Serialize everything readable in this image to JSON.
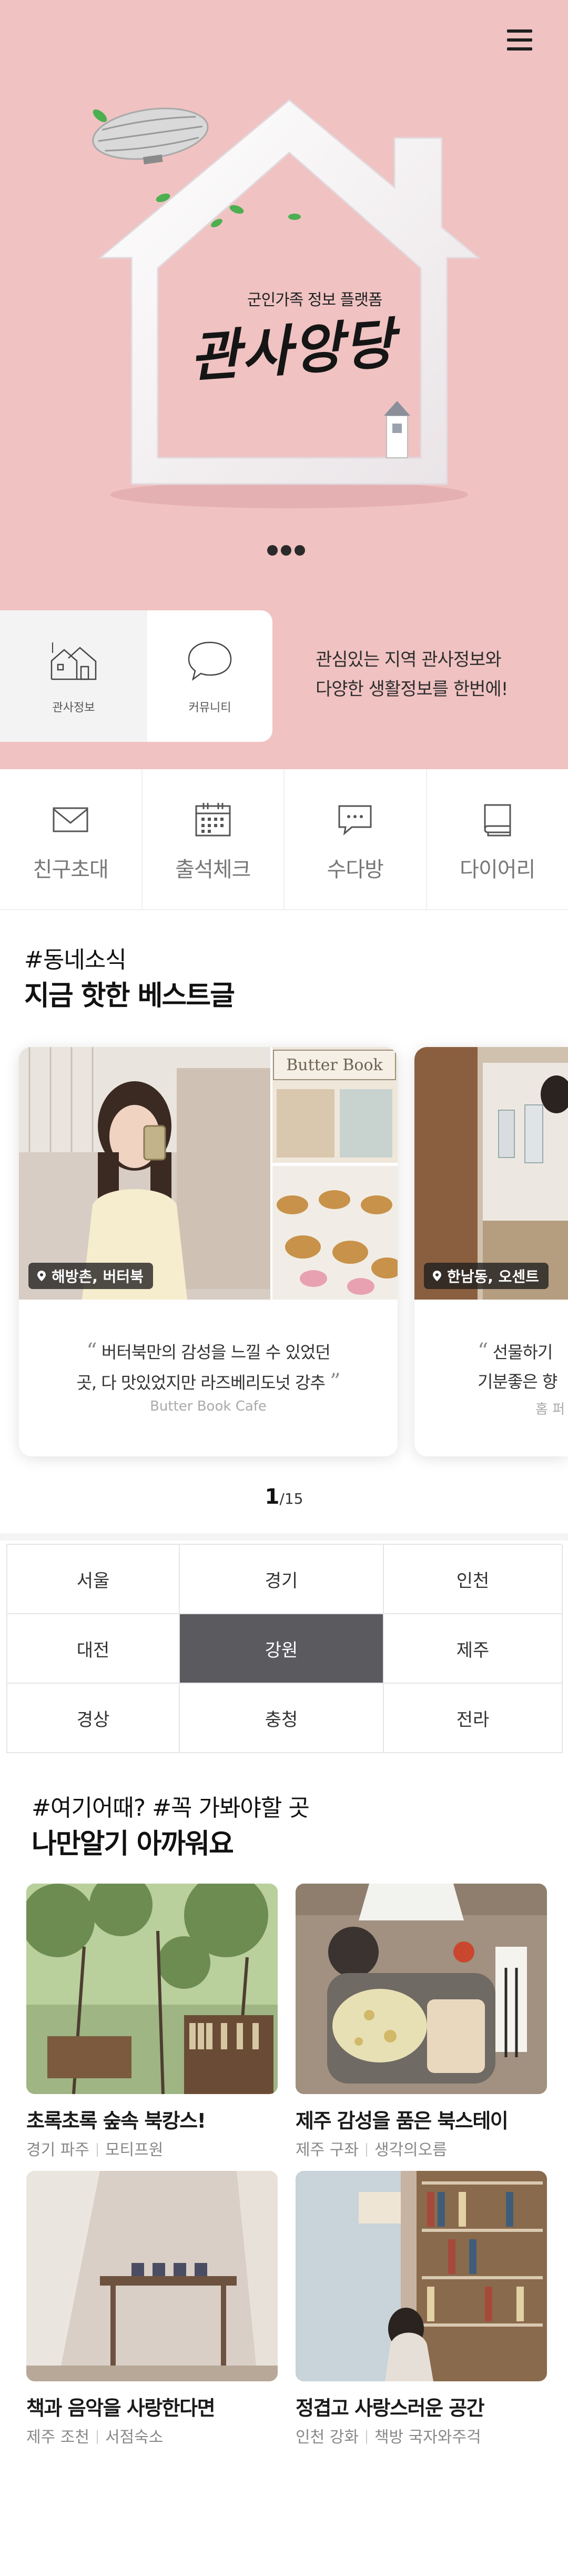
{
  "hero": {
    "subtitle": "군인가족 정보 플랫폼",
    "logo_text": "관사앙당",
    "description_line1": "관심있는 지역 관사정보와",
    "description_line2": "다양한 생활정보를 한번에!",
    "services": [
      {
        "label": "관사정보",
        "icon": "house-icon"
      },
      {
        "label": "커뮤니티",
        "icon": "speech-bubble-icon"
      }
    ],
    "accent_color": "#f0c2c2"
  },
  "quick_menu": [
    {
      "label": "친구초대",
      "icon": "envelope-icon"
    },
    {
      "label": "출석체크",
      "icon": "calendar-icon"
    },
    {
      "label": "수다방",
      "icon": "chat-icon"
    },
    {
      "label": "다이어리",
      "icon": "book-icon"
    }
  ],
  "best": {
    "tag": "#동네소식",
    "title": "지금 핫한 베스트글",
    "cards": [
      {
        "location": "해방촌, 버터북",
        "quote_line1": "버터북만의 감성을 느낄 수 있었던",
        "quote_line2": "곳, 다 맛있었지만 라즈베리도넛 강추",
        "source": "Butter Book Cafe",
        "sign": "Butter Book"
      },
      {
        "location": "한남동, 오센트",
        "quote_line1": "선물하기",
        "quote_line2": "기분좋은 향",
        "source": "홈 퍼"
      }
    ],
    "pager_current": "1",
    "pager_total": "/15"
  },
  "regions": {
    "items": [
      "서울",
      "경기",
      "인천",
      "대전",
      "강원",
      "제주",
      "경상",
      "충청",
      "전라"
    ],
    "selected": "강원"
  },
  "places": {
    "tag": "#여기어때? #꼭 가봐야할 곳",
    "title": "나만알기 아까워요",
    "items": [
      {
        "title": "초록초록 숲속 북캉스!",
        "region": "경기 파주",
        "name": "모티프원"
      },
      {
        "title": "제주 감성을 품은 북스테이",
        "region": "제주 구좌",
        "name": "생각의오름"
      },
      {
        "title": "책과 음악을 사랑한다면",
        "region": "제주 조천",
        "name": "서점숙소"
      },
      {
        "title": "정겹고 사랑스러운 공간",
        "region": "인천 강화",
        "name": "책방 국자와주걱"
      }
    ]
  }
}
